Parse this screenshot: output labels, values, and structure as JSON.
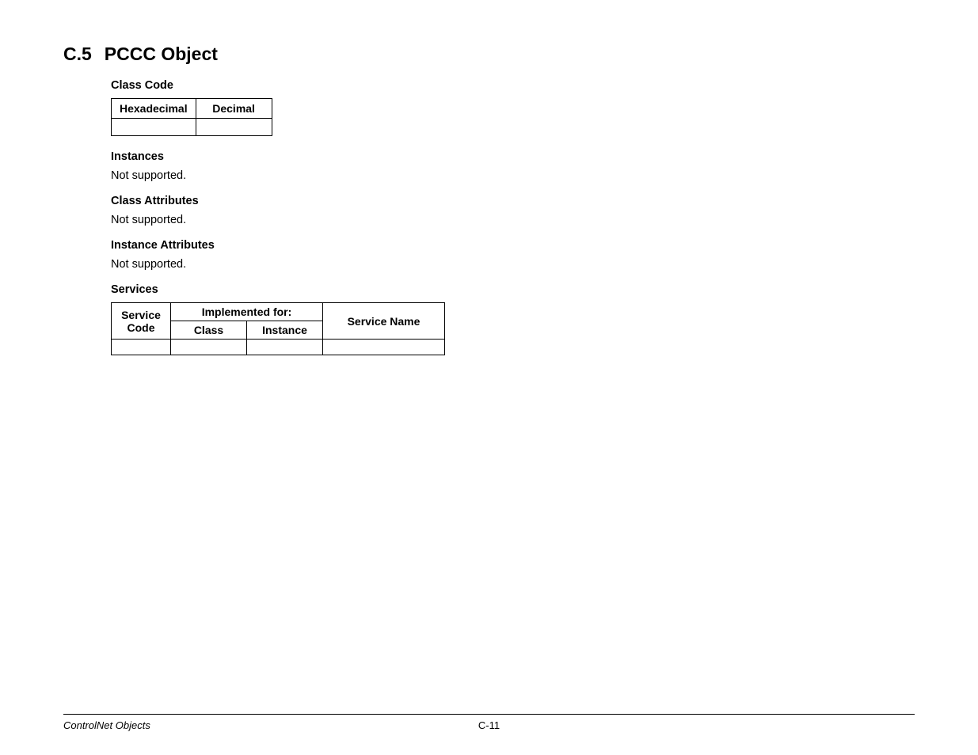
{
  "heading": {
    "number": "C.5",
    "title": "PCCC Object"
  },
  "sections": {
    "classCode": {
      "label": "Class Code",
      "headers": {
        "hex": "Hexadecimal",
        "dec": "Decimal"
      },
      "values": {
        "hex": "",
        "dec": ""
      }
    },
    "instances": {
      "label": "Instances",
      "text": "Not supported."
    },
    "classAttributes": {
      "label": "Class Attributes",
      "text": "Not supported."
    },
    "instanceAttributes": {
      "label": "Instance Attributes",
      "text": "Not supported."
    },
    "services": {
      "label": "Services",
      "headers": {
        "serviceCode": "Service Code",
        "implementedFor": "Implemented for:",
        "class": "Class",
        "instance": "Instance",
        "serviceName": "Service Name"
      },
      "row": {
        "serviceCode": "",
        "class": "",
        "instance": "",
        "serviceName": ""
      }
    }
  },
  "footer": {
    "left": "ControlNet Objects",
    "center": "C-11"
  }
}
